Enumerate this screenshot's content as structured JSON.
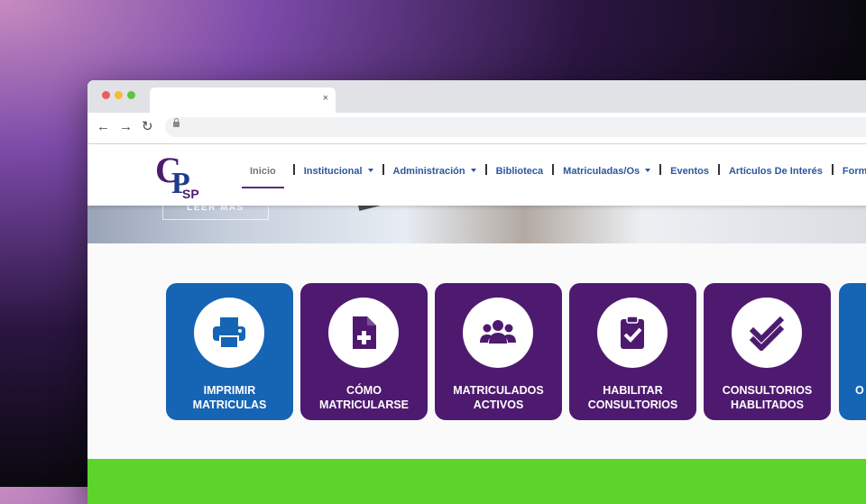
{
  "browser": {
    "tab_close": "×",
    "nav_back": "←",
    "nav_forward": "→",
    "nav_reload": "↻"
  },
  "site": {
    "logo_text_1": "CP",
    "logo_text_2": "SP",
    "hero_button": "LEER MÁS",
    "nav": {
      "inicio": "Inicio",
      "institucional": "Institucional",
      "administracion": "Administración",
      "biblioteca": "Biblioteca",
      "matriculados": "Matriculadas/Os",
      "eventos": "Eventos",
      "articulos": "Artículos De Interés",
      "formacion": "Formación"
    },
    "cards": [
      {
        "line1": "IMPRIMIR",
        "line2": "MATRICULAS",
        "color": "#1664b4",
        "icon": "printer-icon"
      },
      {
        "line1": "CÓMO",
        "line2": "MATRICULARSE",
        "color": "#4e1a70",
        "icon": "file-medical-icon"
      },
      {
        "line1": "MATRICULADOS",
        "line2": "ACTIVOS",
        "color": "#4e1a70",
        "icon": "users-icon"
      },
      {
        "line1": "HABILITAR",
        "line2": "CONSULTORIOS",
        "color": "#4e1a70",
        "icon": "clipboard-check-icon"
      },
      {
        "line1": "CONSULTORIOS",
        "line2": "HABLITADOS",
        "color": "#4e1a70",
        "icon": "double-check-icon"
      },
      {
        "line1": "O",
        "line2": "",
        "color": "#1664b4",
        "icon": "partial-card"
      }
    ]
  },
  "colors": {
    "accent_blue": "#1664b4",
    "accent_purple": "#4e1a70",
    "green_band": "#5ed32c",
    "nav_text": "#2c56a0"
  }
}
